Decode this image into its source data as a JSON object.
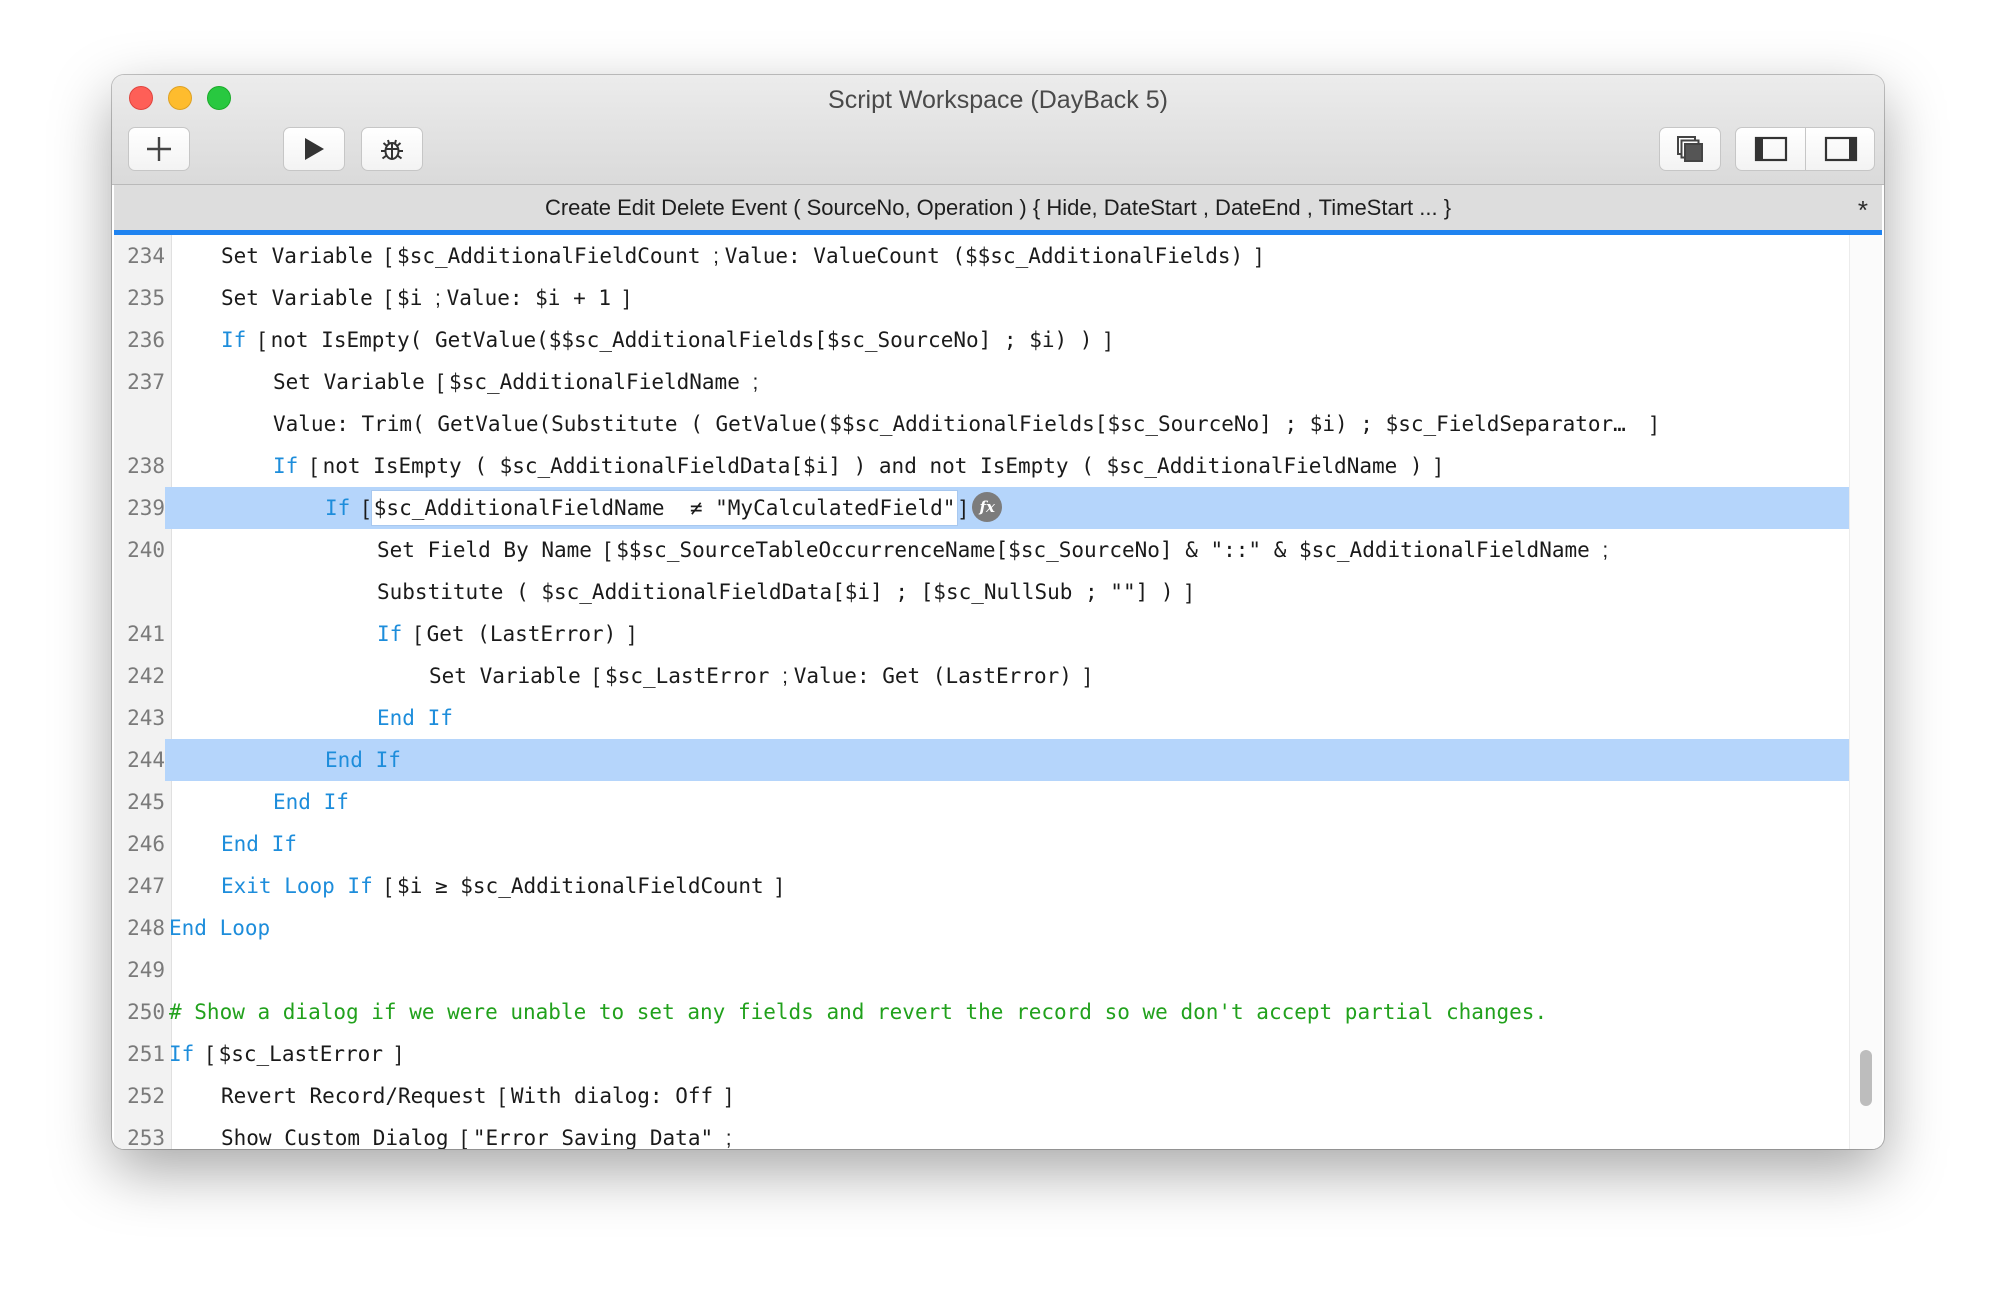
{
  "window": {
    "title": "Script Workspace (DayBack 5)"
  },
  "toolbar": {
    "buttons": [
      {
        "name": "new-script-button",
        "icon": "plus-icon"
      },
      {
        "name": "run-script-button",
        "icon": "play-icon"
      },
      {
        "name": "debug-script-button",
        "icon": "bug-icon"
      },
      {
        "name": "window-arrange-button",
        "icon": "stacked-windows-icon"
      },
      {
        "name": "show-left-sidebar-button",
        "icon": "left-sidebar-icon"
      },
      {
        "name": "show-right-sidebar-button",
        "icon": "right-sidebar-icon"
      }
    ]
  },
  "tab": {
    "title": "Create Edit Delete Event ( SourceNo, Operation ) { Hide, DateStart , DateEnd , TimeStart ... }",
    "modified_marker": "*"
  },
  "script": {
    "selected_lines": [
      "239",
      "244"
    ],
    "lines": [
      {
        "num": "234",
        "indent": 2,
        "parts": [
          [
            "t",
            "Set Variable "
          ],
          [
            "b",
            "[ "
          ],
          [
            "t",
            "$sc_AdditionalFieldCount "
          ],
          [
            "b",
            "; "
          ],
          [
            "t",
            "Value: ValueCount ($$sc_AdditionalFields) "
          ],
          [
            "b",
            "]"
          ]
        ]
      },
      {
        "num": "235",
        "indent": 2,
        "parts": [
          [
            "t",
            "Set Variable "
          ],
          [
            "b",
            "[ "
          ],
          [
            "t",
            "$i "
          ],
          [
            "b",
            "; "
          ],
          [
            "t",
            "Value: $i + 1 "
          ],
          [
            "b",
            "]"
          ]
        ]
      },
      {
        "num": "236",
        "indent": 2,
        "parts": [
          [
            "k",
            "If "
          ],
          [
            "b",
            "[ "
          ],
          [
            "t",
            "not IsEmpty( GetValue($$sc_AdditionalFields[$sc_SourceNo] ; $i) ) "
          ],
          [
            "b",
            "]"
          ]
        ]
      },
      {
        "num": "237",
        "indent": 3,
        "parts": [
          [
            "t",
            "Set Variable "
          ],
          [
            "b",
            "[ "
          ],
          [
            "t",
            "$sc_AdditionalFieldName "
          ],
          [
            "b",
            ";"
          ]
        ]
      },
      {
        "num": "",
        "indent": 3,
        "parts": [
          [
            "t",
            "Value: Trim( GetValue(Substitute ( GetValue($$sc_AdditionalFields[$sc_SourceNo] ; $i) ; $sc_FieldSeparator…  "
          ],
          [
            "b",
            "]"
          ]
        ]
      },
      {
        "num": "238",
        "indent": 3,
        "parts": [
          [
            "k",
            "If "
          ],
          [
            "b",
            "[ "
          ],
          [
            "t",
            "not IsEmpty ( $sc_AdditionalFieldData[$i] ) and not IsEmpty ( $sc_AdditionalFieldName ) "
          ],
          [
            "b",
            "]"
          ]
        ]
      },
      {
        "num": "239",
        "indent": 4,
        "parts": [
          [
            "k",
            "If "
          ],
          [
            "b",
            "["
          ],
          [
            "e",
            "$sc_AdditionalFieldName  ≠ \"MyCalculatedField\""
          ],
          [
            "b",
            "]"
          ],
          [
            "f",
            "fx"
          ]
        ]
      },
      {
        "num": "240",
        "indent": 5,
        "parts": [
          [
            "t",
            "Set Field By Name "
          ],
          [
            "b",
            "[ "
          ],
          [
            "t",
            "$$sc_SourceTableOccurrenceName[$sc_SourceNo] & \"::\" & $sc_AdditionalFieldName "
          ],
          [
            "b",
            ";"
          ]
        ]
      },
      {
        "num": "",
        "indent": 5,
        "parts": [
          [
            "t",
            "Substitute ( $sc_AdditionalFieldData[$i] ; [$sc_NullSub ; \"\"] ) "
          ],
          [
            "b",
            "]"
          ]
        ]
      },
      {
        "num": "241",
        "indent": 5,
        "parts": [
          [
            "k",
            "If "
          ],
          [
            "b",
            "[ "
          ],
          [
            "t",
            "Get (LastError) "
          ],
          [
            "b",
            "]"
          ]
        ]
      },
      {
        "num": "242",
        "indent": 6,
        "parts": [
          [
            "t",
            "Set Variable "
          ],
          [
            "b",
            "[ "
          ],
          [
            "t",
            "$sc_LastError "
          ],
          [
            "b",
            "; "
          ],
          [
            "t",
            "Value: Get (LastError) "
          ],
          [
            "b",
            "]"
          ]
        ]
      },
      {
        "num": "243",
        "indent": 5,
        "parts": [
          [
            "k",
            "End If"
          ]
        ]
      },
      {
        "num": "244",
        "indent": 4,
        "parts": [
          [
            "k",
            "End If"
          ]
        ]
      },
      {
        "num": "245",
        "indent": 3,
        "parts": [
          [
            "k",
            "End If"
          ]
        ]
      },
      {
        "num": "246",
        "indent": 2,
        "parts": [
          [
            "k",
            "End If"
          ]
        ]
      },
      {
        "num": "247",
        "indent": 2,
        "parts": [
          [
            "k",
            "Exit Loop If "
          ],
          [
            "b",
            "[ "
          ],
          [
            "t",
            "$i ≥ $sc_AdditionalFieldCount "
          ],
          [
            "b",
            "]"
          ]
        ]
      },
      {
        "num": "248",
        "indent": 1,
        "parts": [
          [
            "k",
            "End Loop"
          ]
        ]
      },
      {
        "num": "249",
        "indent": 1,
        "parts": []
      },
      {
        "num": "250",
        "indent": 1,
        "parts": [
          [
            "c",
            "# Show a dialog if we were unable to set any fields and revert the record so we don't accept partial changes."
          ]
        ]
      },
      {
        "num": "251",
        "indent": 1,
        "parts": [
          [
            "k",
            "If "
          ],
          [
            "b",
            "[ "
          ],
          [
            "t",
            "$sc_LastError "
          ],
          [
            "b",
            "]"
          ]
        ]
      },
      {
        "num": "252",
        "indent": 2,
        "parts": [
          [
            "t",
            "Revert Record/Request "
          ],
          [
            "b",
            "[ "
          ],
          [
            "t",
            "With dialog: Off "
          ],
          [
            "b",
            "]"
          ]
        ]
      },
      {
        "num": "253",
        "indent": 2,
        "parts": [
          [
            "t",
            "Show Custom Dialog "
          ],
          [
            "b",
            "[ "
          ],
          [
            "t",
            "\"Error Saving Data\" "
          ],
          [
            "b",
            ";"
          ]
        ]
      }
    ]
  },
  "colors": {
    "keyword": "#1d8ddb",
    "comment": "#21a11c",
    "selection": "#b5d5fb",
    "tab_accent": "#1f83f0"
  }
}
